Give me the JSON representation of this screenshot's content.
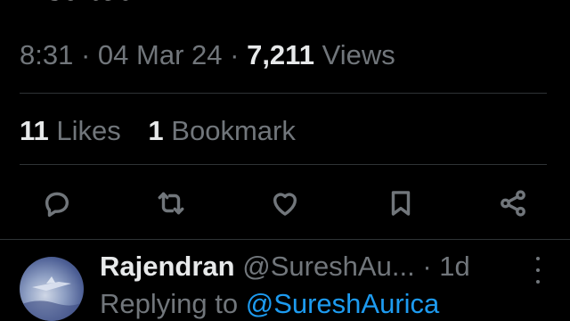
{
  "tweet": {
    "text_clipped": "insulted",
    "time": "8:31",
    "date": "04 Mar 24",
    "views_count": "7,211",
    "views_label": "Views",
    "separator": "·"
  },
  "stats": {
    "likes_count": "11",
    "likes_label": "Likes",
    "bookmarks_count": "1",
    "bookmarks_label": "Bookmark"
  },
  "actions": [
    {
      "name": "reply",
      "icon": "speech-bubble-icon"
    },
    {
      "name": "repost",
      "icon": "repost-arrows-icon"
    },
    {
      "name": "like",
      "icon": "heart-icon"
    },
    {
      "name": "bookmark",
      "icon": "bookmark-icon"
    },
    {
      "name": "share",
      "icon": "share-nodes-icon"
    }
  ],
  "reply": {
    "author_name": "Rajendran",
    "author_handle": "@SureshAu...",
    "separator": "·",
    "time_ago": "1d",
    "replying_prefix": "Replying to",
    "replying_mention": "@SureshAurica"
  },
  "colors": {
    "background": "#000000",
    "primary_text": "#e7e9ea",
    "secondary_text": "#71767b",
    "divider": "#2f3336",
    "accent": "#1d9bf0"
  }
}
